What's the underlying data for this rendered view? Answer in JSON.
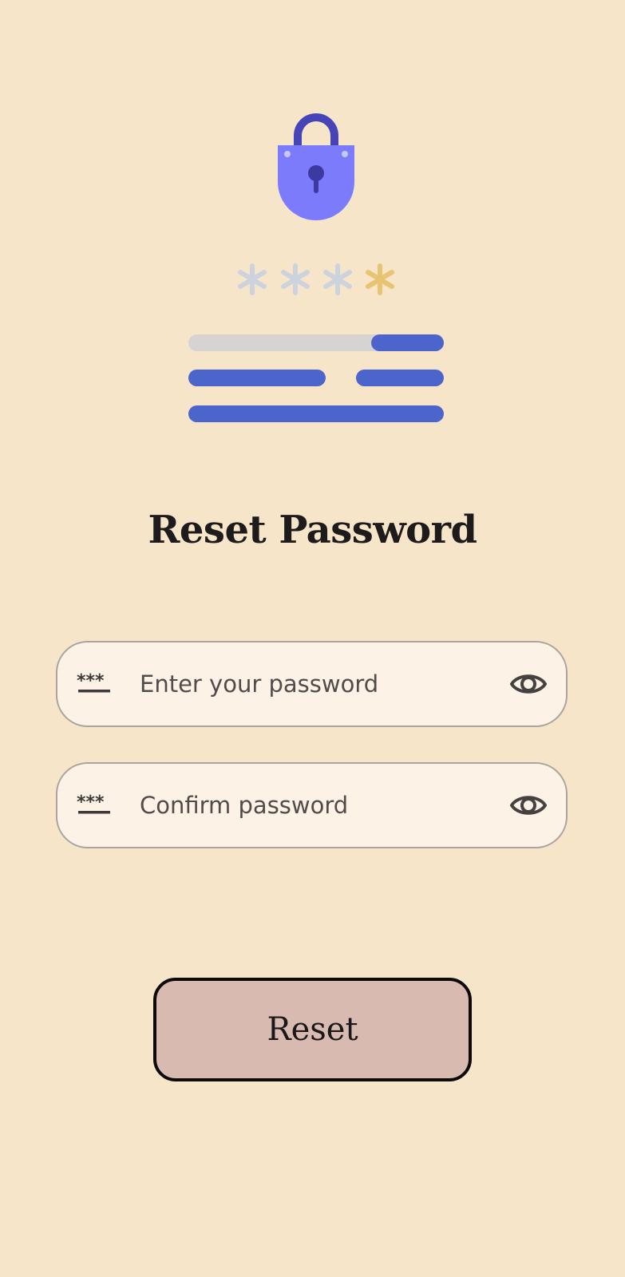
{
  "title": "Reset Password",
  "password_field": {
    "placeholder": "Enter your password",
    "value": "",
    "icon": "password-icon",
    "toggle_icon": "eye-icon"
  },
  "confirm_field": {
    "placeholder": "Confirm password",
    "value": "",
    "icon": "password-icon",
    "toggle_icon": "eye-icon"
  },
  "reset_button": {
    "label": "Reset"
  },
  "colors": {
    "background": "#f7e5ca",
    "field_background": "#fcf3e6",
    "button_background": "#d9bab0",
    "lock_body": "#7b7bfb",
    "lock_shackle": "#4744b8",
    "bars": "#4c65cc",
    "asterisk_gray": "#cdd3dc",
    "asterisk_gold": "#e8c372"
  }
}
